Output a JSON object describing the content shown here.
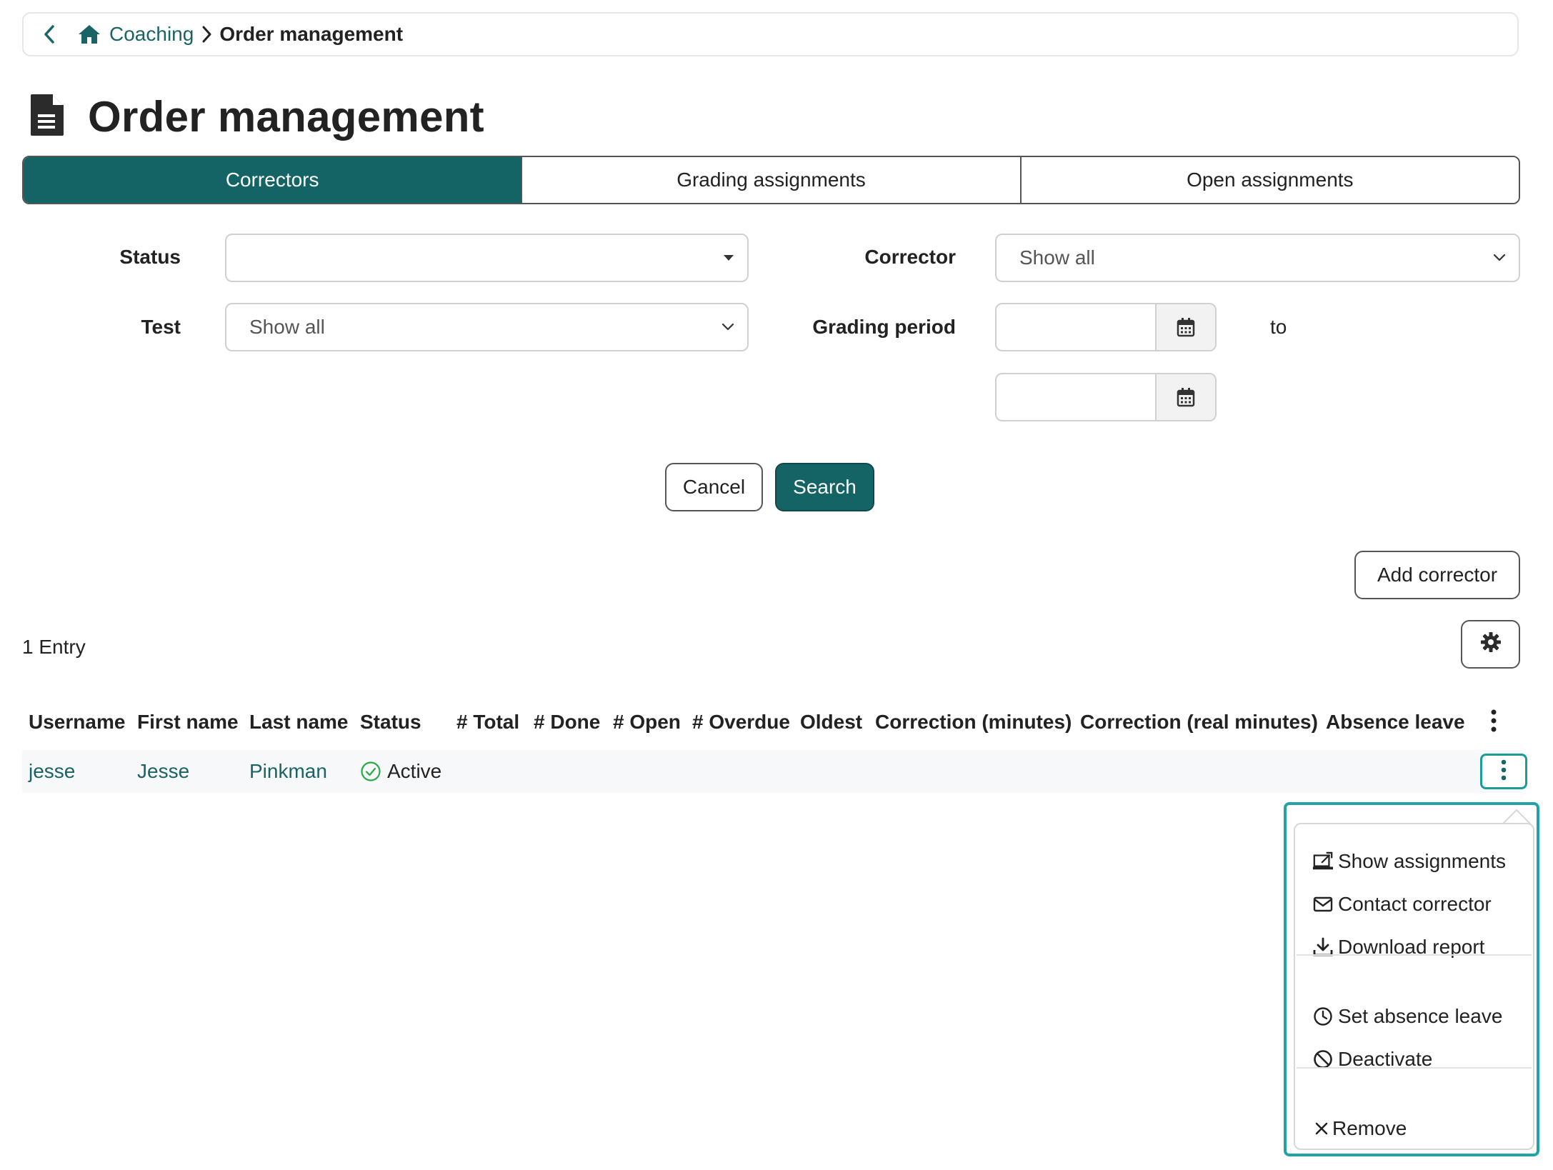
{
  "breadcrumb": {
    "back_icon": "chevron-left-icon",
    "home_icon": "home-icon",
    "parent": "Coaching",
    "current": "Order management"
  },
  "page": {
    "title": "Order management",
    "title_icon": "document-icon"
  },
  "tabs": [
    {
      "label": "Correctors",
      "active": true
    },
    {
      "label": "Grading assignments",
      "active": false
    },
    {
      "label": "Open assignments",
      "active": false
    }
  ],
  "filters": {
    "status": {
      "label": "Status",
      "value": ""
    },
    "corrector": {
      "label": "Corrector",
      "value": "Show all"
    },
    "test": {
      "label": "Test",
      "value": "Show all"
    },
    "grading_period": {
      "label": "Grading period",
      "from": "",
      "to": "",
      "to_label": "to"
    }
  },
  "actions": {
    "cancel": "Cancel",
    "search": "Search",
    "add_corrector": "Add corrector",
    "settings_icon": "gear-icon"
  },
  "table": {
    "entry_count": "1 Entry",
    "columns": [
      "Username",
      "First name",
      "Last name",
      "Status",
      "# Total",
      "# Done",
      "# Open",
      "# Overdue",
      "Oldest",
      "Correction (minutes)",
      "Correction (real minutes)",
      "Absence leave"
    ],
    "rows": [
      {
        "username": "jesse",
        "first_name": "Jesse",
        "last_name": "Pinkman",
        "status": "Active",
        "total": "",
        "done": "",
        "open": "",
        "overdue": "",
        "oldest": "",
        "correction_minutes": "",
        "correction_real_minutes": "",
        "absence_leave": ""
      }
    ]
  },
  "row_menu": {
    "items": [
      {
        "label": "Show assignments",
        "icon": "show-assignments-icon"
      },
      {
        "label": "Contact corrector",
        "icon": "envelope-icon"
      },
      {
        "label": "Download report",
        "icon": "download-icon"
      },
      {
        "label": "Set absence leave",
        "icon": "clock-icon"
      },
      {
        "label": "Deactivate",
        "icon": "ban-icon"
      },
      {
        "label": "Remove",
        "icon": "x-icon"
      }
    ]
  },
  "colors": {
    "accent": "#146466",
    "link": "#1a6466",
    "focus": "#20a3a4",
    "active_status": "#2aa84a"
  }
}
